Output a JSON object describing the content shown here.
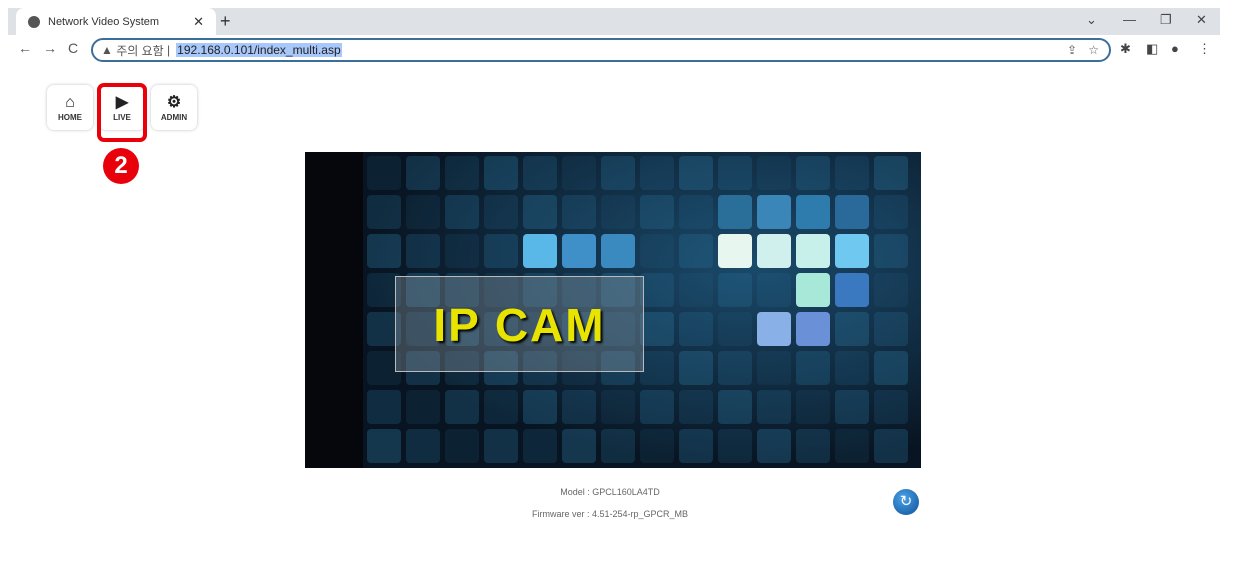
{
  "browser": {
    "tab_title": "Network Video System",
    "security_label": "주의 요함",
    "url": "192.168.0.101/index_multi.asp"
  },
  "nav": [
    {
      "label": "HOME",
      "icon": "home-icon"
    },
    {
      "label": "LIVE",
      "icon": "play-icon"
    },
    {
      "label": "ADMIN",
      "icon": "gear-icon"
    }
  ],
  "annotation": {
    "step": "2",
    "color": "#e8000b"
  },
  "video": {
    "overlay_text": "IP CAM"
  },
  "footer": {
    "model": "Model : GPCL160LA4TD",
    "firmware": "Firmware ver : 4.51-254-rp_GPCR_MB"
  }
}
